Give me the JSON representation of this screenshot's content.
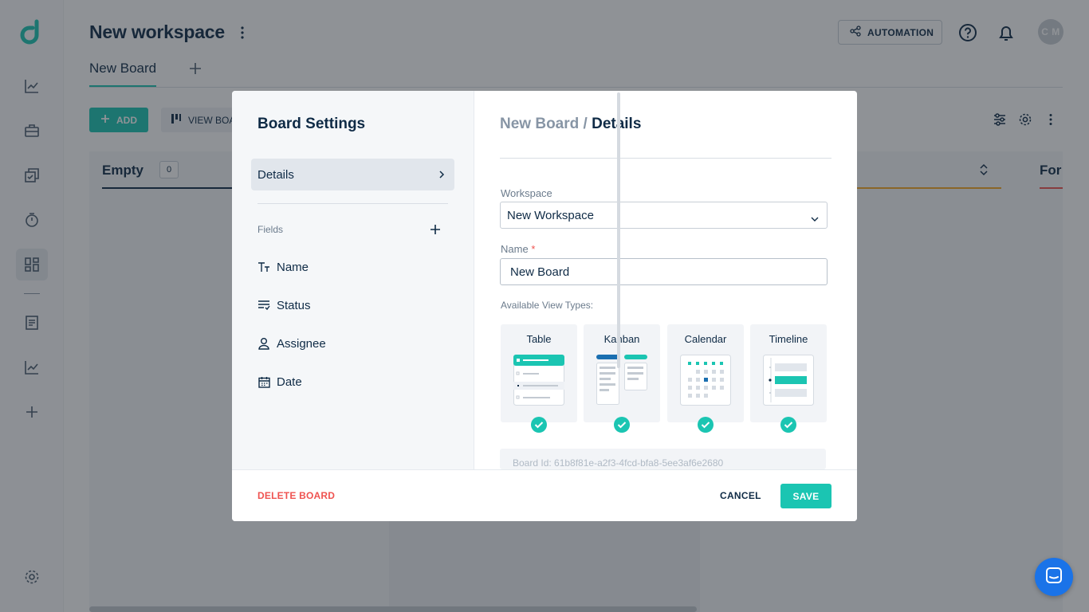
{
  "header": {
    "title": "New workspace",
    "automation_label": "AUTOMATION",
    "avatar_initials": "C M"
  },
  "tabs": [
    {
      "label": "New Board"
    }
  ],
  "toolbar": {
    "add_label": "ADD",
    "view_label": "VIEW BOARD"
  },
  "columns": [
    {
      "name": "Empty",
      "count": "0",
      "color": "#0f2b46"
    },
    {
      "name": "For",
      "color": "#ef5350"
    }
  ],
  "modal": {
    "title": "Board Settings",
    "nav_details": "Details",
    "fields_label": "Fields",
    "fields": [
      {
        "label": "Name",
        "icon": "text-type-icon"
      },
      {
        "label": "Status",
        "icon": "status-list-icon"
      },
      {
        "label": "Assignee",
        "icon": "user-icon"
      },
      {
        "label": "Date",
        "icon": "calendar-icon"
      }
    ],
    "breadcrumb": {
      "board": "New Board",
      "separator": "/",
      "page": "Details"
    },
    "workspace_label": "Workspace",
    "workspace_value": "New Workspace",
    "name_label": "Name",
    "name_required_mark": "*",
    "name_value": "New Board",
    "view_types_label": "Available View Types:",
    "view_types": [
      {
        "label": "Table",
        "checked": true
      },
      {
        "label": "Kanban",
        "checked": true
      },
      {
        "label": "Calendar",
        "checked": true
      },
      {
        "label": "Timeline",
        "checked": true
      }
    ],
    "board_id": "Board Id: 61b8f81e-a2f3-4fcd-bfa8-5ee3af6e2680",
    "delete_label": "DELETE BOARD",
    "cancel_label": "CANCEL",
    "save_label": "SAVE"
  },
  "colors": {
    "accent": "#1bc5b2",
    "primary_text": "#0f2b46",
    "danger": "#ef5350",
    "chat": "#1a73e8"
  }
}
